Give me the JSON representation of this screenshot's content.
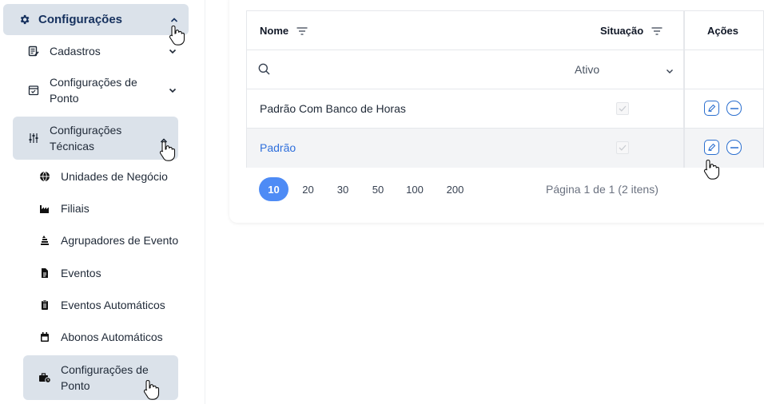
{
  "sidebar": {
    "top": {
      "label": "Configurações",
      "icon": "gear-icon"
    },
    "items": [
      {
        "label": "Cadastros",
        "icon": "edit-list-icon"
      },
      {
        "label": "Configurações de Ponto",
        "icon": "calendar-check-icon"
      },
      {
        "label": "Configurações Técnicas",
        "icon": "sliders-icon"
      }
    ],
    "leaves": [
      {
        "label": "Unidades de Negócio",
        "icon": "globe-icon"
      },
      {
        "label": "Filiais",
        "icon": "factory-icon"
      },
      {
        "label": "Agrupadores de Evento",
        "icon": "stack-icon"
      },
      {
        "label": "Eventos",
        "icon": "document-icon"
      },
      {
        "label": "Eventos Automáticos",
        "icon": "document-clip-icon"
      },
      {
        "label": "Abonos Automáticos",
        "icon": "calendar-icon"
      },
      {
        "label": "Configurações de Ponto",
        "icon": "briefcase-clock-icon"
      }
    ]
  },
  "table": {
    "columns": {
      "nome": "Nome",
      "situacao": "Situação",
      "acoes": "Ações"
    },
    "filter": {
      "status_value": "Ativo"
    },
    "rows": [
      {
        "nome": "Padrão Com Banco de Horas",
        "ativo": true
      },
      {
        "nome": "Padrão",
        "ativo": true
      }
    ]
  },
  "pagination": {
    "sizes": [
      "10",
      "20",
      "30",
      "50",
      "100",
      "200"
    ],
    "selected": "10",
    "info": "Página 1 de 1 (2 itens)"
  },
  "colors": {
    "accent": "#4e8bf5",
    "link": "#2f6fdc",
    "sidebar_active_bg": "#dbe2ea",
    "sidebar_title": "#16315e"
  }
}
